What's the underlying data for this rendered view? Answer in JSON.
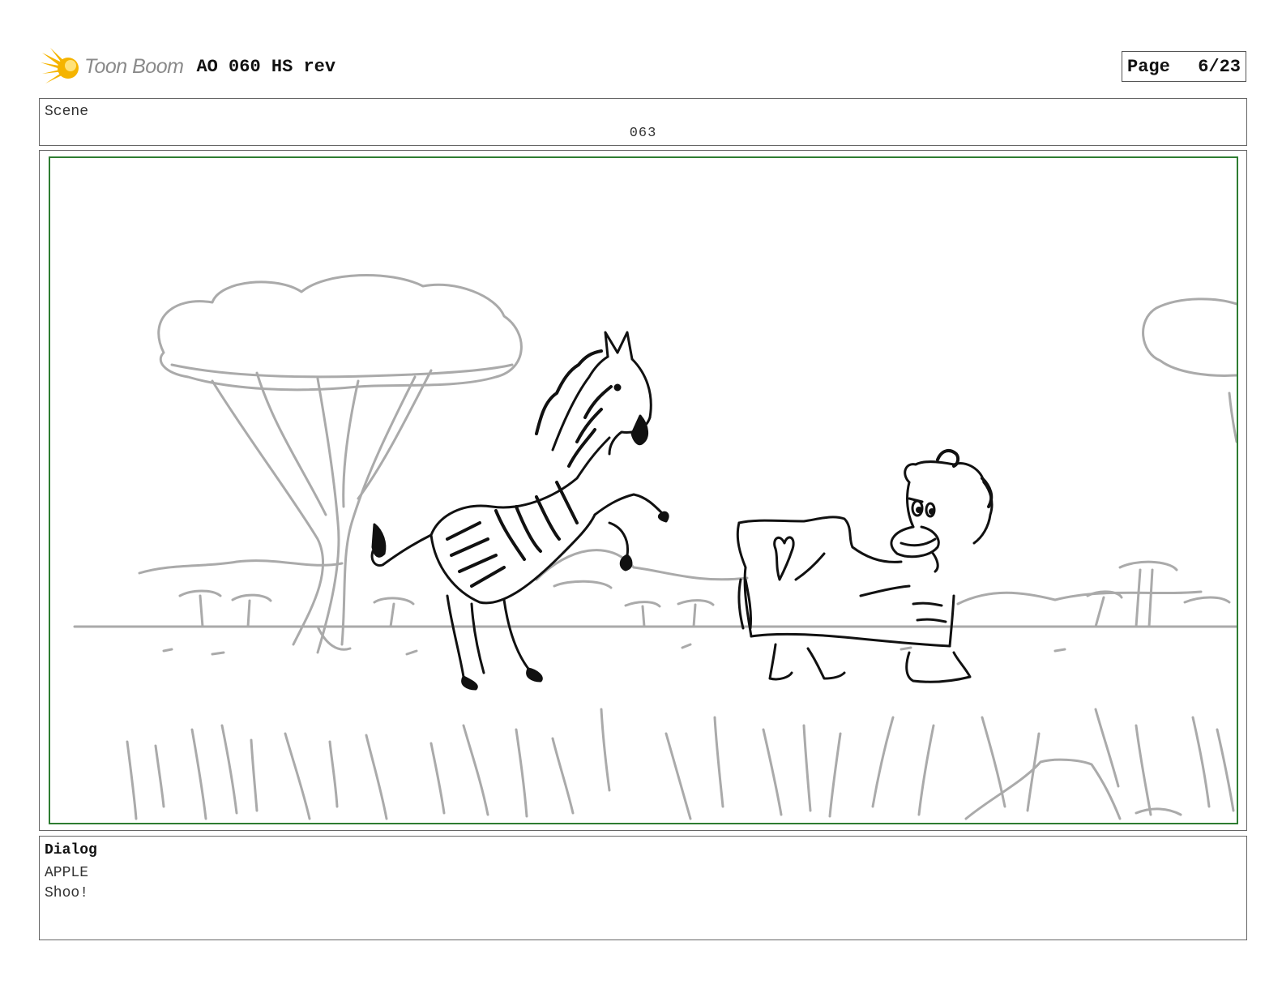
{
  "header": {
    "logo_text": "Toon Boom",
    "logo_icon": "starburst-icon",
    "doc_title": "AO 060 HS rev",
    "page_label": "Page",
    "page_value": "6/23"
  },
  "scene": {
    "label": "Scene",
    "number": "063"
  },
  "panel": {
    "frame_color": "#2e7d32",
    "sketch_color": "#aaaaaa",
    "ink_color": "#111111"
  },
  "dialog": {
    "heading": "Dialog",
    "lines": [
      "APPLE",
      "Shoo!"
    ]
  }
}
